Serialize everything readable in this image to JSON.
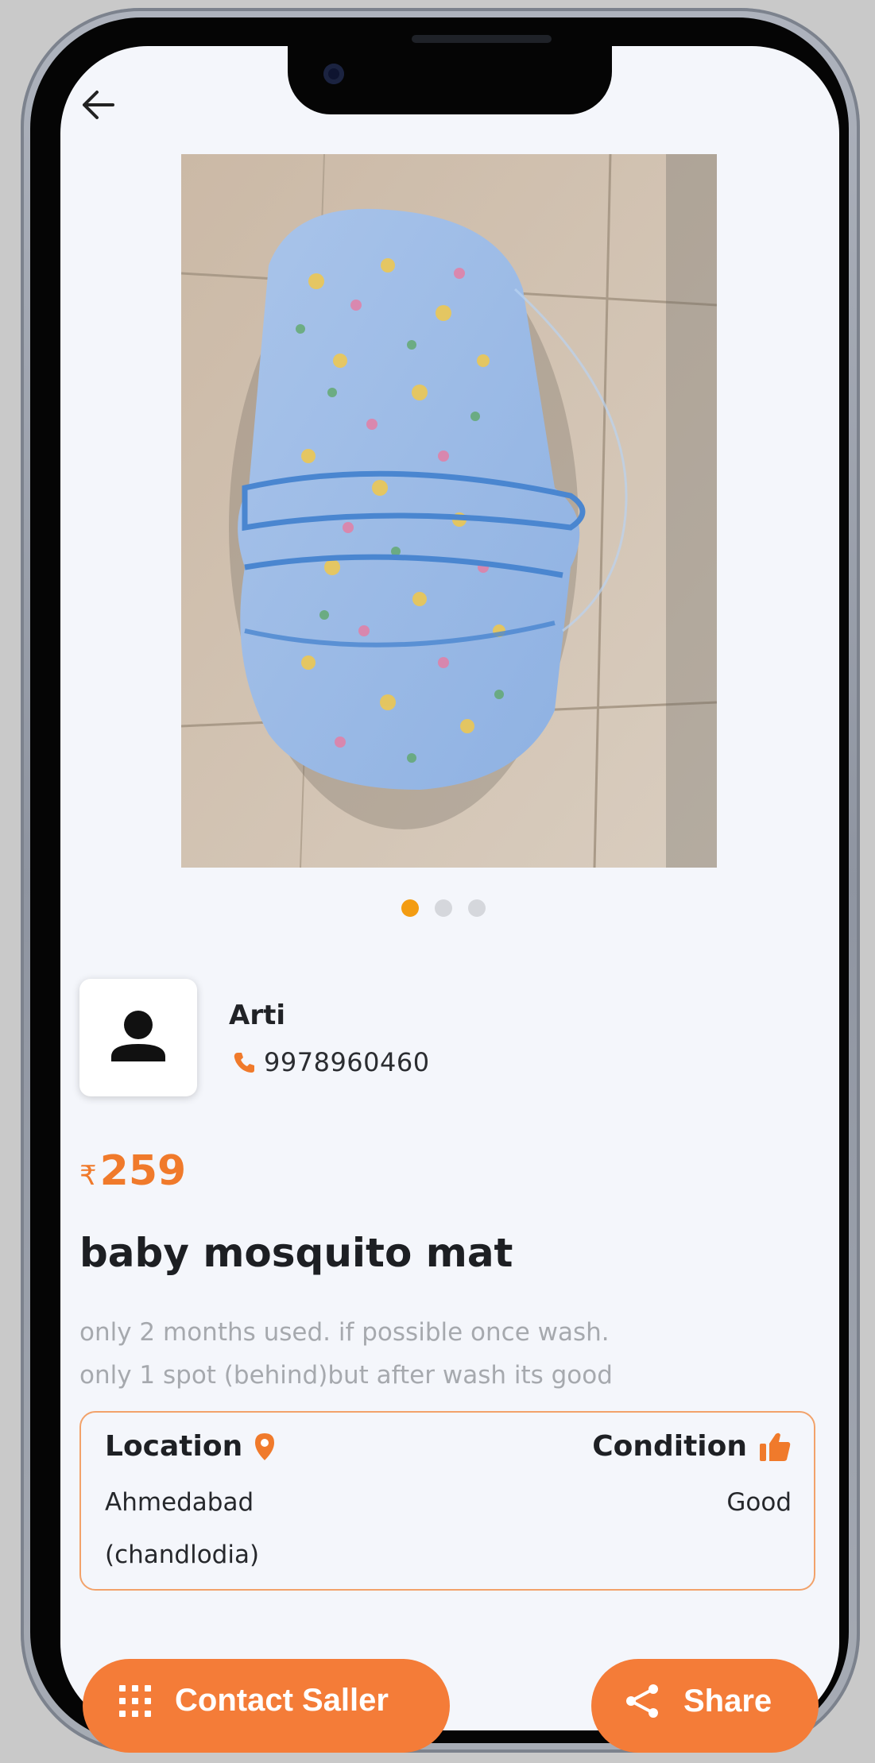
{
  "header": {
    "back_icon": "arrow-left-icon"
  },
  "gallery": {
    "image_count": 3,
    "active_index": 0,
    "accent_color": "#f39c12"
  },
  "seller": {
    "name": "Arti",
    "phone": "9978960460",
    "avatar_icon": "person-icon",
    "phone_icon": "phone-icon"
  },
  "product": {
    "currency": "₹",
    "price": "259",
    "title": "baby mosquito mat",
    "description_line1": "only 2 months used. if possible once wash.",
    "description_line2": "only 1 spot (behind)but after wash its good"
  },
  "info": {
    "location_label": "Location",
    "location_icon": "map-pin-icon",
    "location_line1": "Ahmedabad",
    "location_line2": "(chandlodia)",
    "condition_label": "Condition",
    "condition_icon": "thumbs-up-icon",
    "condition_value": "Good"
  },
  "actions": {
    "contact_label": "Contact Saller",
    "contact_icon": "dial-pad-icon",
    "share_label": "Share",
    "share_icon": "share-icon",
    "button_color": "#f47c38"
  }
}
